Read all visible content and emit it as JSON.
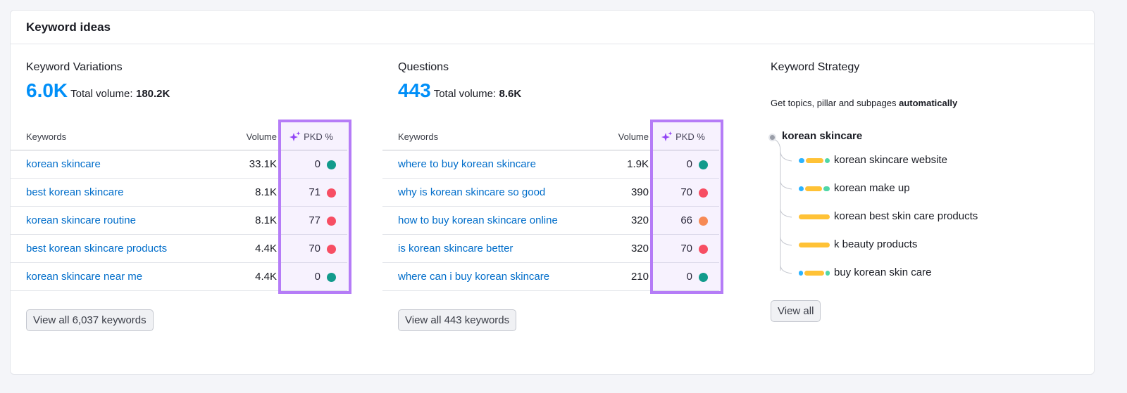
{
  "title": "Keyword ideas",
  "variations": {
    "title": "Keyword Variations",
    "count": "6.0K",
    "total_label": "Total volume:",
    "total": "180.2K",
    "headers": {
      "keywords": "Keywords",
      "volume": "Volume",
      "pkd": "PKD %"
    },
    "rows": [
      {
        "keyword": "korean skincare",
        "volume": "33.1K",
        "pkd": "0",
        "color": "#009f81"
      },
      {
        "keyword": "best korean skincare",
        "volume": "8.1K",
        "pkd": "71",
        "color": "#ff4953"
      },
      {
        "keyword": "korean skincare routine",
        "volume": "8.1K",
        "pkd": "77",
        "color": "#ff4953"
      },
      {
        "keyword": "best korean skincare products",
        "volume": "4.4K",
        "pkd": "70",
        "color": "#ff4953"
      },
      {
        "keyword": "korean skincare near me",
        "volume": "4.4K",
        "pkd": "0",
        "color": "#009f81"
      }
    ],
    "button": "View all 6,037 keywords"
  },
  "questions": {
    "title": "Questions",
    "count": "443",
    "total_label": "Total volume:",
    "total": "8.6K",
    "headers": {
      "keywords": "Keywords",
      "volume": "Volume",
      "pkd": "PKD %"
    },
    "rows": [
      {
        "keyword": "where to buy korean skincare",
        "volume": "1.9K",
        "pkd": "0",
        "color": "#009f81"
      },
      {
        "keyword": "why is korean skincare so good",
        "volume": "390",
        "pkd": "70",
        "color": "#ff4953"
      },
      {
        "keyword": "how to buy korean skincare online",
        "volume": "320",
        "pkd": "66",
        "color": "#ff8c43"
      },
      {
        "keyword": "is korean skincare better",
        "volume": "320",
        "pkd": "70",
        "color": "#ff4953"
      },
      {
        "keyword": "where can i buy korean skincare",
        "volume": "210",
        "pkd": "0",
        "color": "#009f81"
      }
    ],
    "button": "View all 443 keywords"
  },
  "strategy": {
    "title": "Keyword Strategy",
    "subtitle": "Get topics, pillar and subpages ",
    "subtitle_bold": "automatically",
    "root": "korean skincare",
    "children": [
      {
        "label": "korean skincare website",
        "segments": [
          0.2,
          0.62,
          0.18
        ]
      },
      {
        "label": "korean make up",
        "segments": [
          0.18,
          0.6,
          0.22
        ]
      },
      {
        "label": "korean best skin care products",
        "segments": [
          0,
          1,
          0
        ]
      },
      {
        "label": "k beauty products",
        "segments": [
          0,
          1,
          0
        ]
      },
      {
        "label": "buy korean skin care",
        "segments": [
          0.14,
          0.72,
          0.14
        ]
      }
    ],
    "segment_colors": [
      "#2bb3ff",
      "#ffc236",
      "#4fd7a7"
    ],
    "button": "View all"
  },
  "colors": {
    "accent": "#008ff8",
    "link": "#006dca",
    "pkd_highlight": "#b57cf7"
  }
}
